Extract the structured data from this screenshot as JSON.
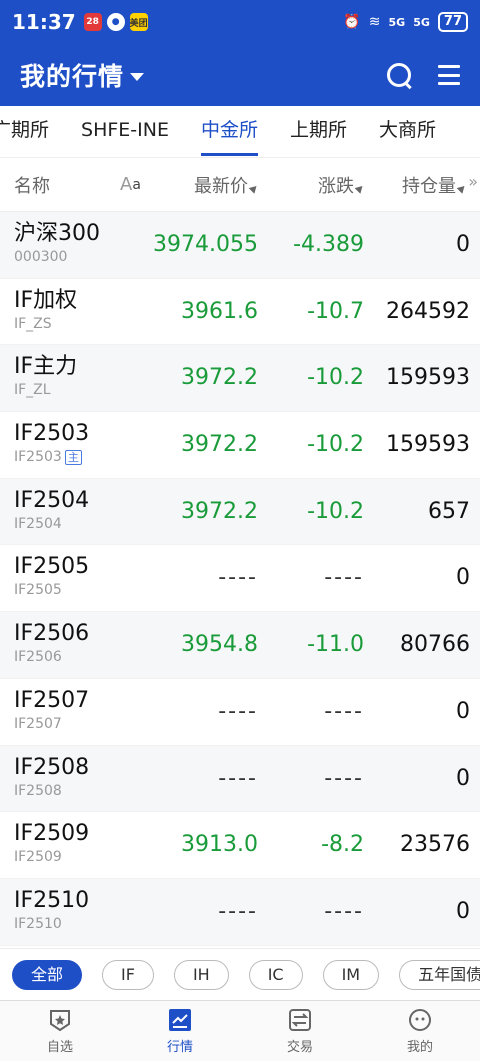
{
  "status": {
    "time": "11:37",
    "badge1": "28",
    "badge3": "美团",
    "sig1": "5G",
    "sig2": "5G",
    "battery": "77"
  },
  "header": {
    "title": "我的行情"
  },
  "tabs": [
    {
      "label": "广期所"
    },
    {
      "label": "SHFE-INE"
    },
    {
      "label": "中金所"
    },
    {
      "label": "上期所"
    },
    {
      "label": "大商所"
    }
  ],
  "columns": {
    "name": "名称",
    "font_a1": "A",
    "font_a2": "a",
    "last": "最新价",
    "chg": "涨跌",
    "oi": "持仓量"
  },
  "rows": [
    {
      "name": "沪深300",
      "code": "000300",
      "last": "3974.055",
      "chg": "-4.389",
      "oi": "0"
    },
    {
      "name": "IF加权",
      "code": "IF_ZS",
      "last": "3961.6",
      "chg": "-10.7",
      "oi": "264592"
    },
    {
      "name": "IF主力",
      "code": "IF_ZL",
      "last": "3972.2",
      "chg": "-10.2",
      "oi": "159593"
    },
    {
      "name": "IF2503",
      "code": "IF2503",
      "tag": "主",
      "last": "3972.2",
      "chg": "-10.2",
      "oi": "159593"
    },
    {
      "name": "IF2504",
      "code": "IF2504",
      "last": "3972.2",
      "chg": "-10.2",
      "oi": "657"
    },
    {
      "name": "IF2505",
      "code": "IF2505",
      "last": "----",
      "chg": "----",
      "oi": "0"
    },
    {
      "name": "IF2506",
      "code": "IF2506",
      "last": "3954.8",
      "chg": "-11.0",
      "oi": "80766"
    },
    {
      "name": "IF2507",
      "code": "IF2507",
      "last": "----",
      "chg": "----",
      "oi": "0"
    },
    {
      "name": "IF2508",
      "code": "IF2508",
      "last": "----",
      "chg": "----",
      "oi": "0"
    },
    {
      "name": "IF2509",
      "code": "IF2509",
      "last": "3913.0",
      "chg": "-8.2",
      "oi": "23576"
    },
    {
      "name": "IF2510",
      "code": "IF2510",
      "last": "----",
      "chg": "----",
      "oi": "0"
    }
  ],
  "chips": [
    {
      "label": "全部"
    },
    {
      "label": "IF"
    },
    {
      "label": "IH"
    },
    {
      "label": "IC"
    },
    {
      "label": "IM"
    },
    {
      "label": "五年国债"
    }
  ],
  "nav": [
    {
      "label": "自选"
    },
    {
      "label": "行情"
    },
    {
      "label": "交易"
    },
    {
      "label": "我的"
    }
  ],
  "colors": {
    "brand": "#1f4fc7",
    "down": "#1a9b3a"
  }
}
